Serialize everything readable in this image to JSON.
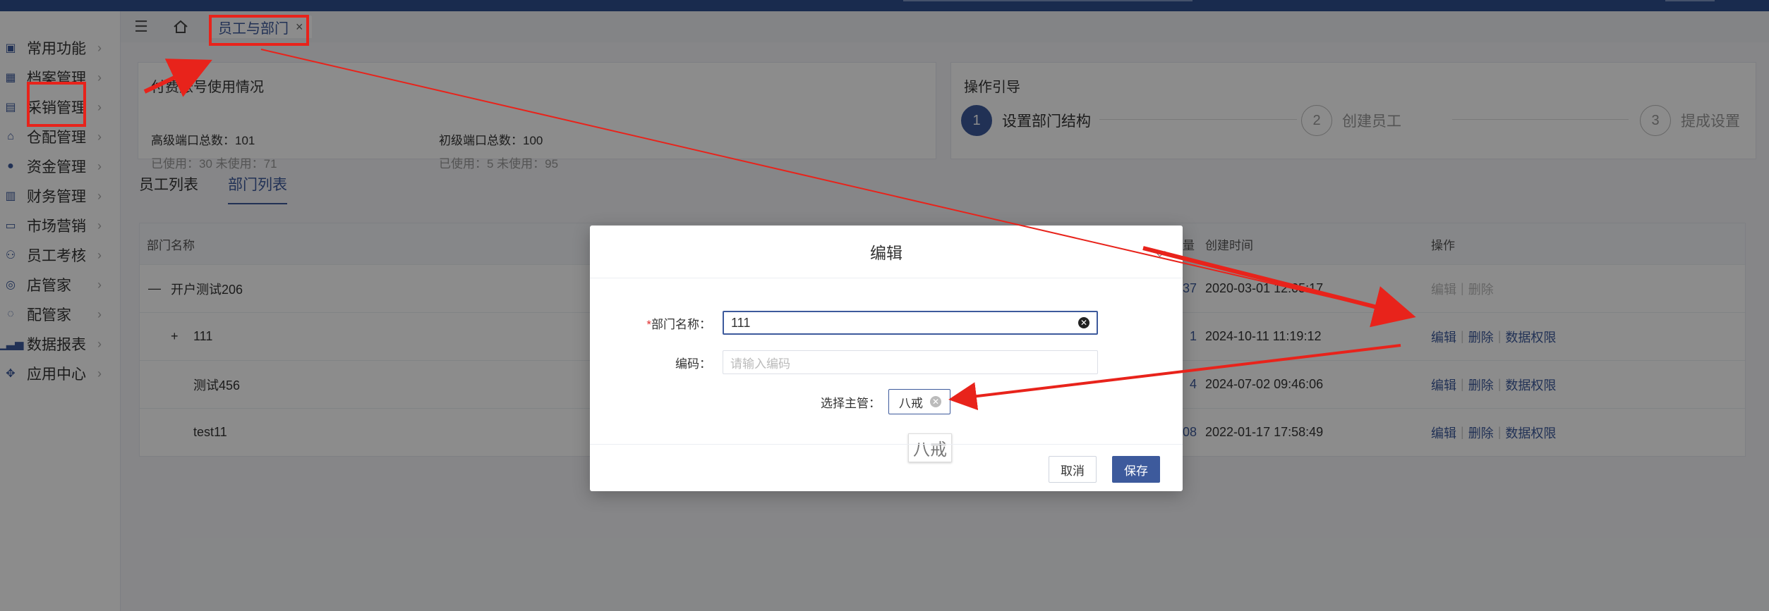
{
  "tab": {
    "label": "员工与部门",
    "close": "×"
  },
  "sidebar": {
    "items": [
      {
        "label": "常用功能",
        "icon": "layer-icon"
      },
      {
        "label": "档案管理",
        "icon": "grid-icon"
      },
      {
        "label": "采销管理",
        "icon": "clipboard-icon"
      },
      {
        "label": "仓配管理",
        "icon": "warehouse-icon"
      },
      {
        "label": "资金管理",
        "icon": "money-bag-icon"
      },
      {
        "label": "财务管理",
        "icon": "calculator-icon"
      },
      {
        "label": "市场营销",
        "icon": "store-icon"
      },
      {
        "label": "员工考核",
        "icon": "users-icon"
      },
      {
        "label": "店管家",
        "icon": "shop-icon"
      },
      {
        "label": "配管家",
        "icon": "chat-icon"
      },
      {
        "label": "数据报表",
        "icon": "chart-icon"
      },
      {
        "label": "应用中心",
        "icon": "apps-icon"
      }
    ]
  },
  "usage": {
    "title": "付费账号使用情况",
    "advanced_total": "高级端口总数：101",
    "advanced_used": "已使用：30   未使用：71",
    "basic_total": "初级端口总数：100",
    "basic_used": "已使用：5   未使用：95"
  },
  "guide": {
    "title": "操作引导",
    "steps": [
      {
        "num": "1",
        "label": "设置部门结构"
      },
      {
        "num": "2",
        "label": "创建员工"
      },
      {
        "num": "3",
        "label": "提成设置"
      }
    ]
  },
  "subtabs": [
    "员工列表",
    "部门列表"
  ],
  "table": {
    "headers": {
      "name": "部门名称",
      "count": "量",
      "created": "创建时间",
      "ops": "操作"
    },
    "rows": [
      {
        "expander": "—",
        "name": "开户测试206",
        "count": "37",
        "created": "2020-03-01 12:05:17",
        "ops": [
          "编辑",
          "删除"
        ]
      },
      {
        "expander": "+",
        "name": "111",
        "count": "1",
        "created": "2024-10-11 11:19:12",
        "ops": [
          "编辑",
          "删除",
          "数据权限"
        ]
      },
      {
        "expander": "",
        "name": "测试456",
        "count": "4",
        "created": "2024-07-02 09:46:06",
        "ops": [
          "编辑",
          "删除",
          "数据权限"
        ]
      },
      {
        "expander": "",
        "name": "test11",
        "count": "08",
        "created": "2022-01-17 17:58:49",
        "ops": [
          "编辑",
          "删除",
          "数据权限"
        ]
      }
    ]
  },
  "dialog": {
    "title": "编辑",
    "name_label": "部门名称：",
    "required_mark": "*",
    "name_value": "111",
    "code_label": "编码：",
    "code_placeholder": "请输入编码",
    "manager_label": "选择主管：",
    "manager_value": "八戒",
    "tooltip": "八戒",
    "cancel": "取消",
    "save": "保存"
  },
  "colors": {
    "accent": "#3d5a9c",
    "annotation": "#e8231b"
  }
}
